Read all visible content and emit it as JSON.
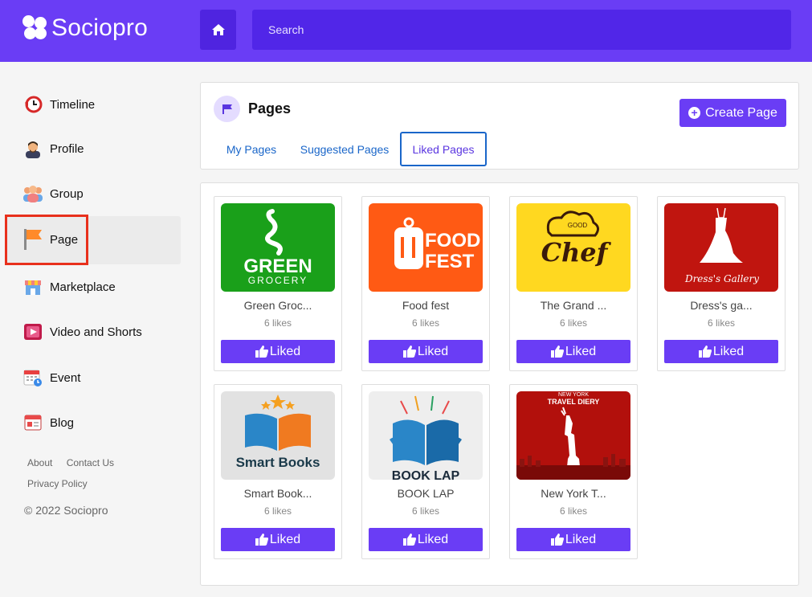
{
  "brand": {
    "name": "Sociopro"
  },
  "search": {
    "placeholder": "Search"
  },
  "sidebar": {
    "items": [
      {
        "label": "Timeline",
        "icon": "timeline-icon"
      },
      {
        "label": "Profile",
        "icon": "profile-icon"
      },
      {
        "label": "Group",
        "icon": "group-icon"
      },
      {
        "label": "Page",
        "icon": "flag-icon",
        "active": true
      },
      {
        "label": "Marketplace",
        "icon": "store-icon"
      },
      {
        "label": "Video and Shorts",
        "icon": "video-icon"
      },
      {
        "label": "Event",
        "icon": "calendar-icon"
      },
      {
        "label": "Blog",
        "icon": "blog-icon"
      }
    ],
    "footer": {
      "about": "About",
      "contact": "Contact Us",
      "privacy": "Privacy Policy",
      "copyright": "© 2022 Sociopro"
    }
  },
  "pages": {
    "title": "Pages",
    "create_label": "Create Page",
    "tabs": [
      "My Pages",
      "Suggested Pages",
      "Liked Pages"
    ],
    "active_tab": "Liked Pages"
  },
  "cards": [
    {
      "name": "Green Groc...",
      "likes": "6 likes",
      "button": "Liked",
      "thumb_text": [
        "GREEN",
        "GROCERY"
      ],
      "bg": "#1aa01a"
    },
    {
      "name": "Food fest",
      "likes": "6 likes",
      "button": "Liked",
      "thumb_text": [
        "FOOD",
        "FEST"
      ],
      "bg": "#ff5a14"
    },
    {
      "name": "The Grand ...",
      "likes": "6 likes",
      "button": "Liked",
      "thumb_text": [
        "GOOD",
        "Chef"
      ],
      "bg": "#ffd820"
    },
    {
      "name": "Dress's ga...",
      "likes": "6 likes",
      "button": "Liked",
      "thumb_text": [
        "Dress's Gallery"
      ],
      "bg": "#c0150f"
    },
    {
      "name": "Smart Book...",
      "likes": "6 likes",
      "button": "Liked",
      "thumb_text": [
        "Smart Books"
      ],
      "bg": "#e2e2e2"
    },
    {
      "name": "BOOK LAP",
      "likes": "6 likes",
      "button": "Liked",
      "thumb_text": [
        "BOOK LAP"
      ],
      "bg": "#eeeeee"
    },
    {
      "name": "New York T...",
      "likes": "6 likes",
      "button": "Liked",
      "thumb_text": [
        "NEW YORK",
        "TRAVEL DIERY"
      ],
      "bg": "#b2100c"
    }
  ]
}
